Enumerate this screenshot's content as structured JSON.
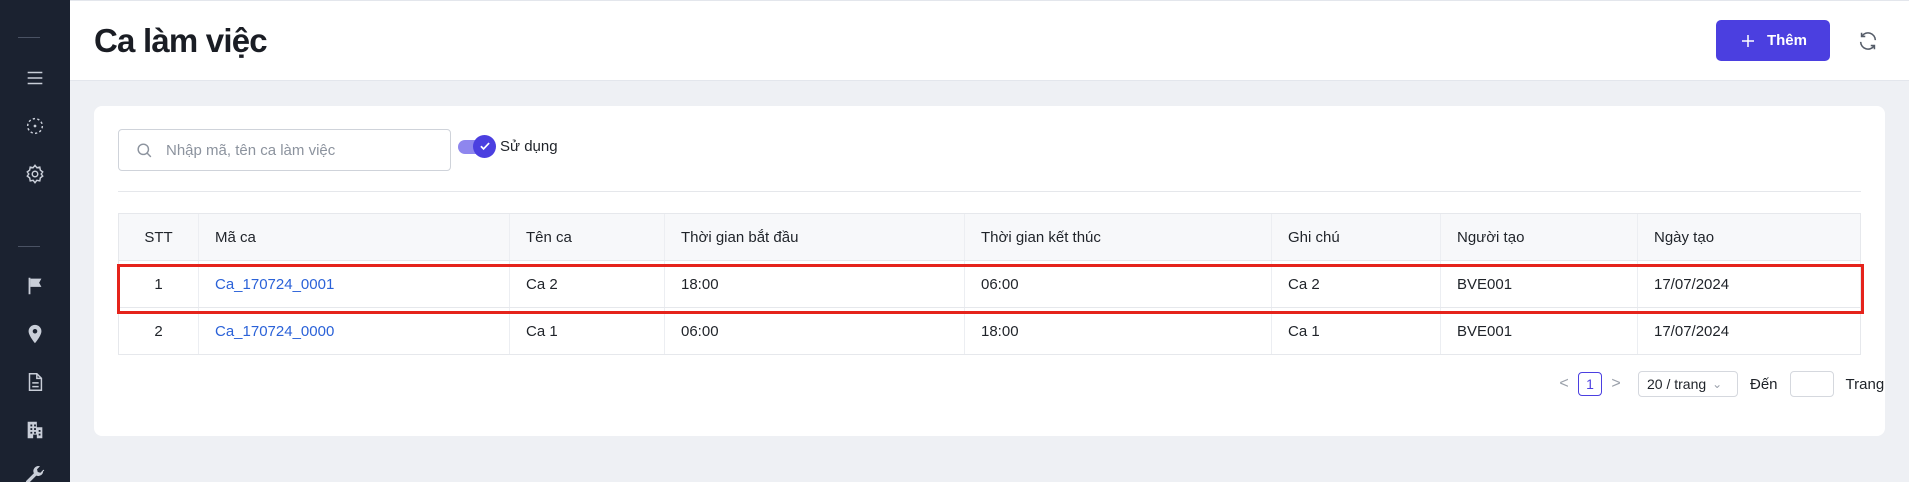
{
  "header": {
    "title": "Ca làm việc",
    "add_label": "Thêm"
  },
  "filters": {
    "search_placeholder": "Nhập mã, tên ca làm việc",
    "toggle_label": "Sử dụng",
    "toggle_on": true
  },
  "table": {
    "columns": [
      "STT",
      "Mã ca",
      "Tên ca",
      "Thời gian bắt đầu",
      "Thời gian kết thúc",
      "Ghi chú",
      "Người tạo",
      "Ngày tạo"
    ],
    "rows": [
      [
        "1",
        "Ca_170724_0001",
        "Ca 2",
        "18:00",
        "06:00",
        "Ca 2",
        "BVE001",
        "17/07/2024"
      ],
      [
        "2",
        "Ca_170724_0000",
        "Ca 1",
        "06:00",
        "18:00",
        "Ca 1",
        "BVE001",
        "17/07/2024"
      ]
    ]
  },
  "pagination": {
    "prev": "<",
    "current": "1",
    "next": ">",
    "page_size": "20 / trang",
    "goto_label": "Đến",
    "page_label": "Trang"
  },
  "colors": {
    "accent": "#4b3fe0",
    "sidebar": "#1b2230",
    "link": "#2b62d8",
    "highlight": "#e5231b"
  },
  "sidebar_icons": [
    "menu-icon",
    "selection-icon",
    "settings-icon",
    "flag-icon",
    "location-icon",
    "document-icon",
    "building-icon",
    "wrench-icon"
  ]
}
